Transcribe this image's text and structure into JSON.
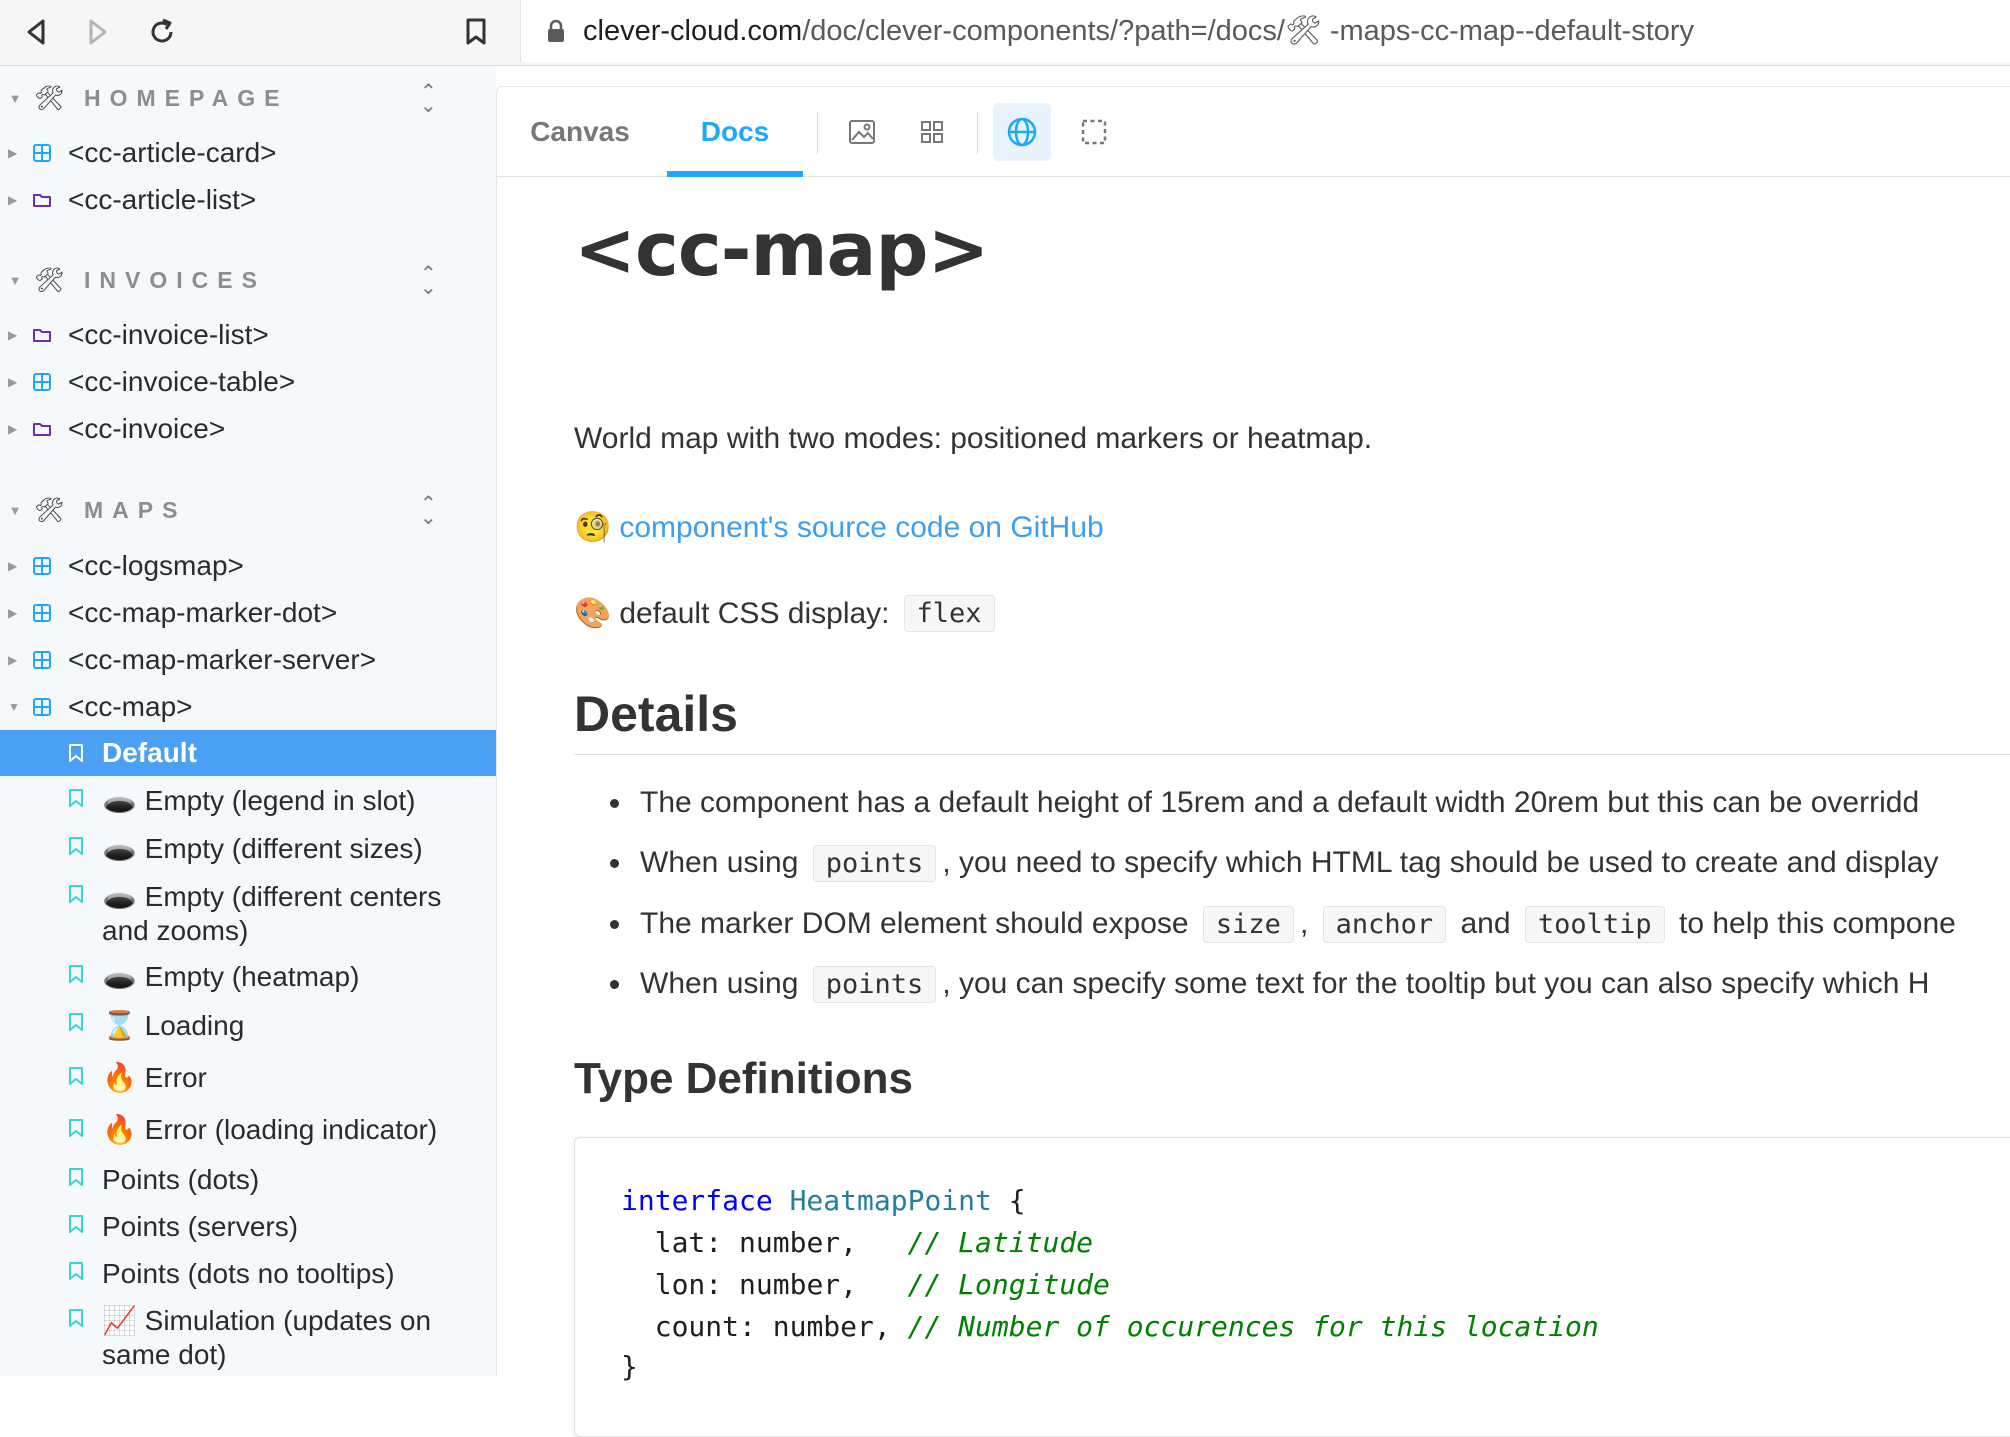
{
  "browser": {
    "url_host": "clever-cloud.com",
    "url_path": "/doc/clever-components/?path=/docs/🛠 -maps-cc-map--default-story"
  },
  "sidebar": {
    "groups": [
      {
        "label": "HOMEPAGE",
        "items": [
          {
            "label": "<cc-article-card>",
            "kind": "component"
          },
          {
            "label": "<cc-article-list>",
            "kind": "folder"
          }
        ]
      },
      {
        "label": "INVOICES",
        "items": [
          {
            "label": "<cc-invoice-list>",
            "kind": "folder"
          },
          {
            "label": "<cc-invoice-table>",
            "kind": "component"
          },
          {
            "label": "<cc-invoice>",
            "kind": "folder"
          }
        ]
      },
      {
        "label": "MAPS",
        "items": [
          {
            "label": "<cc-logsmap>",
            "kind": "component"
          },
          {
            "label": "<cc-map-marker-dot>",
            "kind": "component"
          },
          {
            "label": "<cc-map-marker-server>",
            "kind": "component"
          },
          {
            "label": "<cc-map>",
            "kind": "component",
            "expanded": true
          }
        ]
      }
    ],
    "stories": [
      {
        "label": "Default",
        "selected": true
      },
      {
        "label": "🕳️ Empty (legend in slot)"
      },
      {
        "label": "🕳️ Empty (different sizes)"
      },
      {
        "label": "🕳️ Empty (different centers and zooms)"
      },
      {
        "label": "🕳️ Empty (heatmap)"
      },
      {
        "label": "⌛ Loading"
      },
      {
        "label": "🔥 Error"
      },
      {
        "label": "🔥 Error (loading indicator)"
      },
      {
        "label": "Points (dots)"
      },
      {
        "label": "Points (servers)"
      },
      {
        "label": "Points (dots no tooltips)"
      },
      {
        "label": "📈 Simulation (updates on same dot)"
      }
    ]
  },
  "tabs": {
    "canvas": "Canvas",
    "docs": "Docs",
    "active": "Docs"
  },
  "toolbar_icons": [
    "image-background-icon",
    "grid-icon",
    "globe-icon",
    "outline-icon"
  ],
  "doc": {
    "title": "<cc-map>",
    "description": "World map with two modes: positioned markers or heatmap.",
    "github_emoji": "🧐",
    "github_link": "component's source code on GitHub",
    "css_emoji": "🎨",
    "css_label": "default CSS display:",
    "css_value": "flex",
    "details_heading": "Details",
    "bullets": [
      {
        "parts": [
          {
            "t": "The component has a default height of 15rem and a default width 20rem but this can be overridd"
          }
        ]
      },
      {
        "parts": [
          {
            "t": "When using "
          },
          {
            "c": "points"
          },
          {
            "t": ", you need to specify which HTML tag should be used to create and display"
          }
        ]
      },
      {
        "parts": [
          {
            "t": "The marker DOM element should expose "
          },
          {
            "c": "size"
          },
          {
            "t": ", "
          },
          {
            "c": "anchor"
          },
          {
            "t": " and "
          },
          {
            "c": "tooltip"
          },
          {
            "t": " to help this compone"
          }
        ]
      },
      {
        "parts": [
          {
            "t": "When using "
          },
          {
            "c": "points"
          },
          {
            "t": ", you can specify some text for the tooltip but you can also specify which H"
          }
        ]
      }
    ],
    "typedefs_heading": "Type Definitions",
    "code": {
      "keyword": "interface",
      "type_name": "HeatmapPoint",
      "open": " {",
      "fields": [
        {
          "name": "lat",
          "type": "number,",
          "pad": "   ",
          "comment": "// Latitude"
        },
        {
          "name": "lon",
          "type": "number,",
          "pad": "   ",
          "comment": "// Longitude"
        },
        {
          "name": "count",
          "type": "number,",
          "pad": " ",
          "comment": "// Number of occurences for this location"
        }
      ],
      "close": "}"
    }
  },
  "colors": {
    "accent": "#1ea7fd",
    "selected_bg": "#4aa1f3",
    "link": "#3d9ff0",
    "component_icon": "#1ea7fd",
    "folder_icon": "#6f2cac",
    "story_icon": "#37d5d3"
  }
}
